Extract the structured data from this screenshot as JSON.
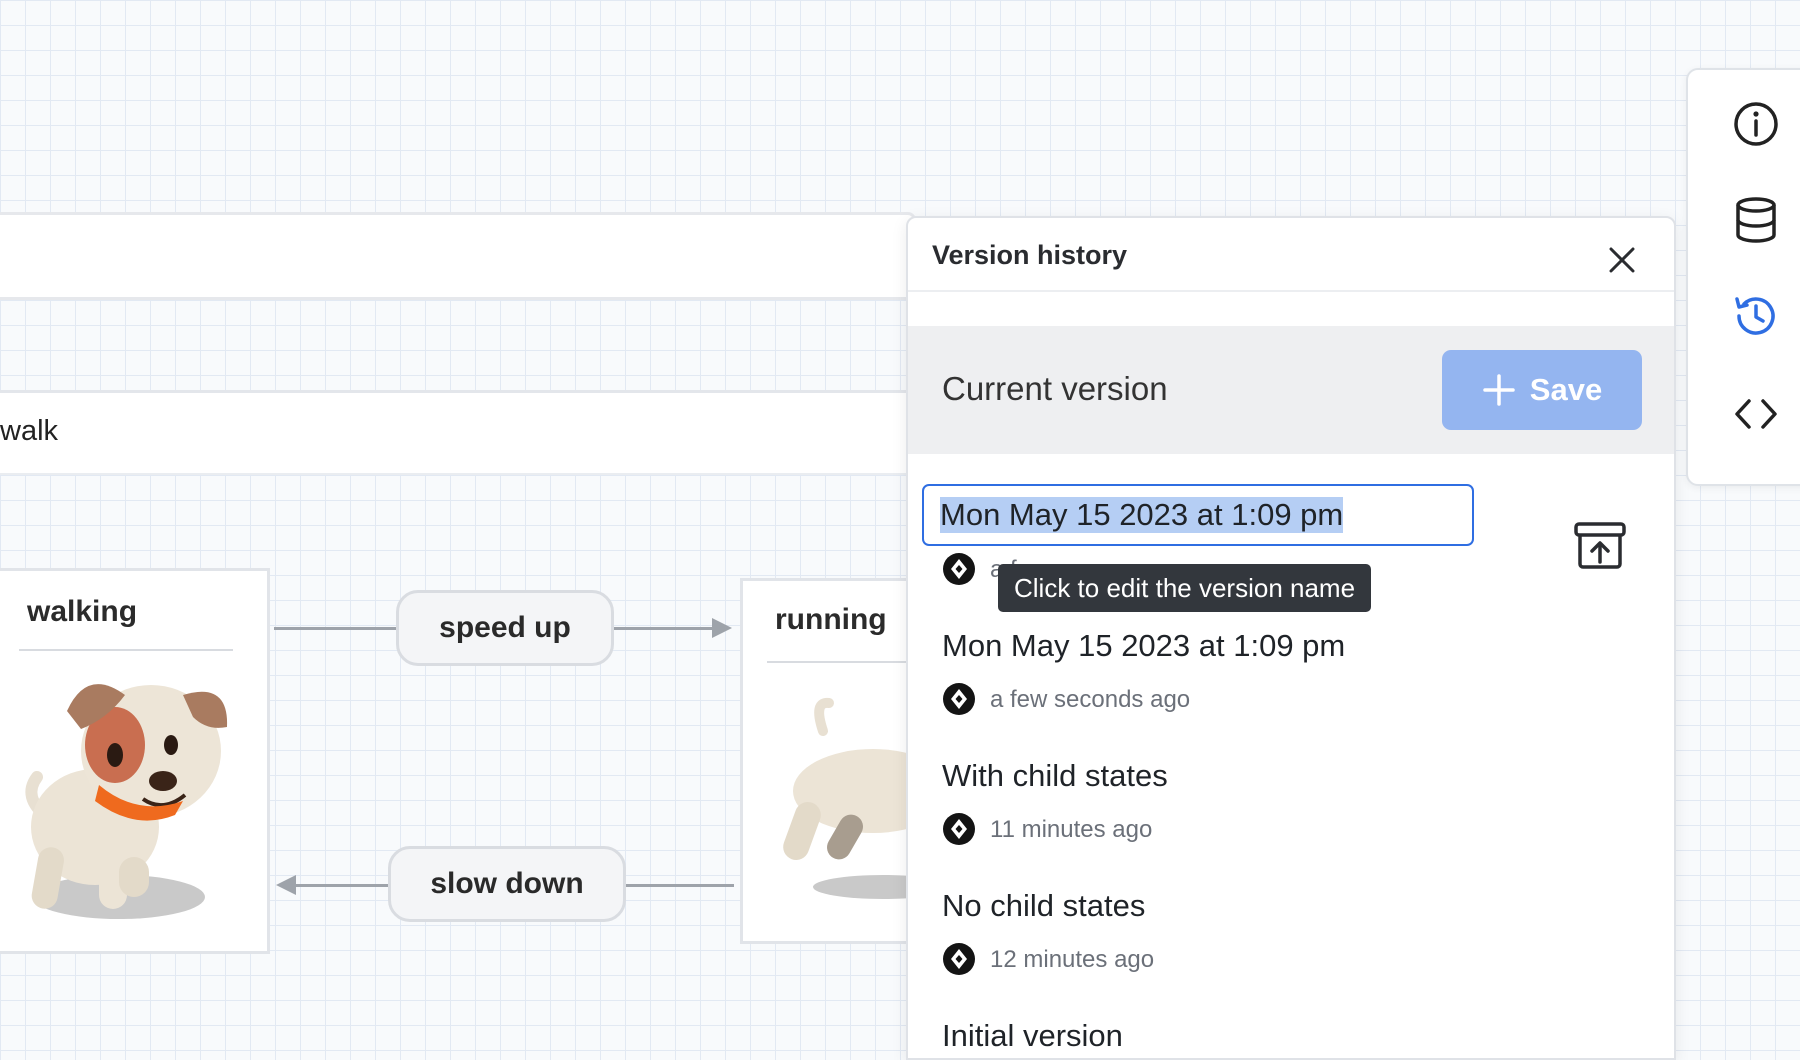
{
  "canvas": {
    "parent_state": "walk",
    "states": [
      {
        "title": "walking"
      },
      {
        "title": "running"
      }
    ],
    "events": {
      "speed_up": "speed up",
      "slow_down": "slow down"
    }
  },
  "rail": {
    "icons": [
      "info-icon",
      "database-icon",
      "history-icon",
      "code-icon"
    ],
    "active": "history-icon",
    "active_color": "#2f6ee2"
  },
  "version_panel": {
    "title": "Version history",
    "current_label": "Current version",
    "save_label": "Save",
    "editing_value": "Mon May 15 2023 at 1:09 pm",
    "tooltip": "Click to edit the version name",
    "editing_time_fragment": "a f",
    "versions": [
      {
        "name": "Mon May 15 2023 at 1:09 pm",
        "time": "a few seconds ago"
      },
      {
        "name": "With child states",
        "time": "11 minutes ago"
      },
      {
        "name": "No child states",
        "time": "12 minutes ago"
      },
      {
        "name": "Initial version",
        "time": ""
      }
    ]
  },
  "colors": {
    "accent": "#2f6ee2",
    "save_button": "#94b5f0",
    "tooltip_bg": "#33373d"
  }
}
